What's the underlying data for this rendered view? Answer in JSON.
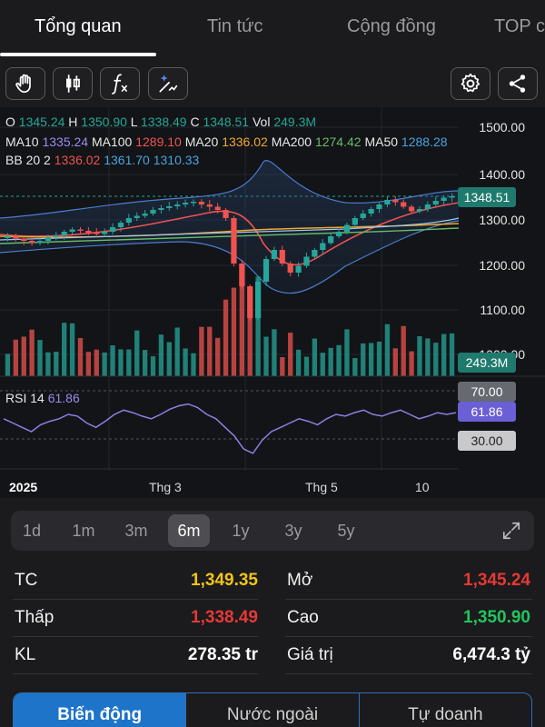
{
  "tabs": [
    "Tổng quan",
    "Tin tức",
    "Cộng đồng",
    "TOP c"
  ],
  "toolbar": {
    "icons": [
      "hand-icon",
      "candlestick-icon",
      "function-icon",
      "magic-icon",
      "gear-icon",
      "share-icon"
    ]
  },
  "ohlc": {
    "o_label": "O",
    "o": "1345.24",
    "h_label": "H",
    "h": "1350.90",
    "l_label": "L",
    "l": "1338.49",
    "c_label": "C",
    "c": "1348.51",
    "vol_label": "Vol",
    "vol": "249.3M"
  },
  "ma": {
    "ma10_label": "MA10",
    "ma10": "1335.24",
    "ma100_label": "MA100",
    "ma100": "1289.10",
    "ma20_label": "MA20",
    "ma20": "1336.02",
    "ma200_label": "MA200",
    "ma200": "1274.42",
    "ma50_label": "MA50",
    "ma50": "1288.28"
  },
  "bb": {
    "label": "BB 20 2",
    "mid": "1336.02",
    "upper": "1361.70",
    "lower": "1310.33"
  },
  "price_axis": [
    "1500.00",
    "1400.00",
    "1300.00",
    "1200.00",
    "1100.00",
    "1000.00"
  ],
  "current_price_tag": "1348.51",
  "volume_tag": "249.3M",
  "rsi": {
    "label": "RSI 14",
    "value": "61.86",
    "upper": "70.00",
    "lower": "30.00"
  },
  "time_axis": [
    "2025",
    "Thg 3",
    "Thg 5",
    "10"
  ],
  "ranges": [
    "1d",
    "1m",
    "3m",
    "6m",
    "1y",
    "3y",
    "5y"
  ],
  "active_range": "6m",
  "stats": {
    "tc_label": "TC",
    "tc": "1,349.35",
    "mo_label": "Mở",
    "mo": "1,345.24",
    "thap_label": "Thấp",
    "thap": "1,338.49",
    "cao_label": "Cao",
    "cao": "1,350.90",
    "kl_label": "KL",
    "kl": "278.35 tr",
    "gt_label": "Giá trị",
    "gt": "6,474.3 tỷ"
  },
  "bottom_tabs": [
    "Biến động",
    "Nước ngoài",
    "Tự doanh"
  ],
  "colors": {
    "up": "#26a69a",
    "down": "#ef5350",
    "ref": "#f0c419",
    "accent": "#1e74c8"
  },
  "chart_data": {
    "type": "candlestick",
    "price_ylim": [
      1000,
      1500
    ],
    "close_path": [
      1260,
      1255,
      1250,
      1245,
      1250,
      1258,
      1262,
      1270,
      1275,
      1272,
      1268,
      1265,
      1270,
      1280,
      1290,
      1300,
      1305,
      1310,
      1318,
      1322,
      1326,
      1330,
      1334,
      1336,
      1330,
      1325,
      1318,
      1300,
      1200,
      1150,
      1080,
      1160,
      1210,
      1230,
      1200,
      1180,
      1195,
      1215,
      1230,
      1245,
      1260,
      1270,
      1285,
      1300,
      1310,
      1320,
      1330,
      1340,
      1335,
      1325,
      1315,
      1320,
      1330,
      1338,
      1345,
      1348
    ],
    "rsi_values": [
      55,
      50,
      45,
      40,
      48,
      52,
      55,
      60,
      58,
      50,
      45,
      52,
      60,
      65,
      62,
      58,
      55,
      60,
      66,
      70,
      72,
      68,
      60,
      55,
      45,
      35,
      20,
      15,
      30,
      40,
      45,
      50,
      55,
      52,
      48,
      55,
      60,
      58,
      62,
      65,
      60,
      58,
      62,
      65,
      60,
      55,
      58,
      62,
      60,
      62
    ],
    "rsi_ylim": [
      0,
      100
    ]
  }
}
